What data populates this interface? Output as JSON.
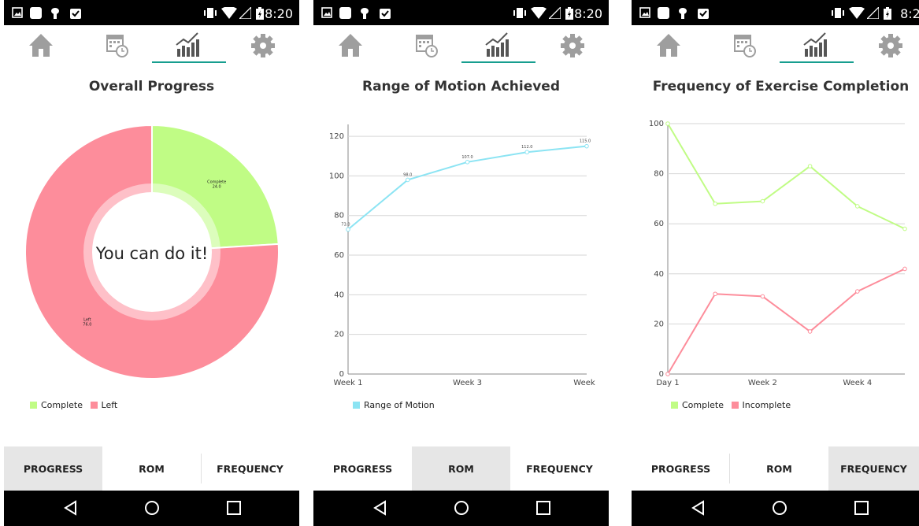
{
  "status_bar": {
    "time": "8:20"
  },
  "top_tabs": [
    {
      "icon": "home-icon"
    },
    {
      "icon": "calendar-clock-icon"
    },
    {
      "icon": "chart-progress-icon",
      "active": true
    },
    {
      "icon": "gear-icon"
    }
  ],
  "bottom_tabs": [
    "PROGRESS",
    "ROM",
    "FREQUENCY"
  ],
  "colors": {
    "accent": "#179e8f",
    "green": "#c0fc85",
    "red": "#fd8d9b",
    "cyan": "#8ce4f3"
  },
  "screens": [
    {
      "title": "Overall Progress",
      "center_text": "You can do it!",
      "active_bottom_tab": 0,
      "legend": [
        "Complete",
        "Left"
      ],
      "chart_data": {
        "type": "pie",
        "categories": [
          "Complete",
          "Left"
        ],
        "values": [
          24.0,
          76.0
        ],
        "value_labels": [
          "24.0",
          "76.0"
        ],
        "title": "Overall Progress",
        "legend_position": "bottom-left"
      }
    },
    {
      "title": "Range of Motion Achieved",
      "active_bottom_tab": 1,
      "legend": [
        "Range of Motion"
      ],
      "chart_data": {
        "type": "line",
        "x": [
          1,
          2,
          3,
          4,
          5
        ],
        "x_tick_labels": [
          "Week 1",
          "Week 3",
          "Week"
        ],
        "series": [
          {
            "name": "Range of Motion",
            "values": [
              73.0,
              98.0,
              107.0,
              112.0,
              115.0
            ],
            "value_labels": [
              "73.0",
              "98.0",
              "107.0",
              "112.0",
              "115.0"
            ]
          }
        ],
        "title": "Range of Motion Achieved",
        "ylim": [
          0,
          126
        ],
        "y_ticks": [
          0,
          20,
          40,
          60,
          80,
          100,
          120
        ],
        "grid": true,
        "legend_position": "bottom-left"
      }
    },
    {
      "title": "Frequency of Exercise Completion",
      "active_bottom_tab": 2,
      "legend": [
        "Complete",
        "Incomplete"
      ],
      "chart_data": {
        "type": "line",
        "x": [
          1,
          2,
          3,
          4,
          5,
          6
        ],
        "x_tick_labels": [
          "Day 1",
          "Week 2",
          "Week 4"
        ],
        "series": [
          {
            "name": "Complete",
            "values": [
              100,
              68,
              69,
              83,
              67,
              58
            ]
          },
          {
            "name": "Incomplete",
            "values": [
              0,
              32,
              31,
              17,
              33,
              42
            ]
          }
        ],
        "title": "Frequency of Exercise Completion",
        "ylim": [
          0,
          100
        ],
        "y_ticks": [
          0,
          20,
          40,
          60,
          80,
          100
        ],
        "grid": true,
        "legend_position": "bottom-left"
      }
    }
  ]
}
